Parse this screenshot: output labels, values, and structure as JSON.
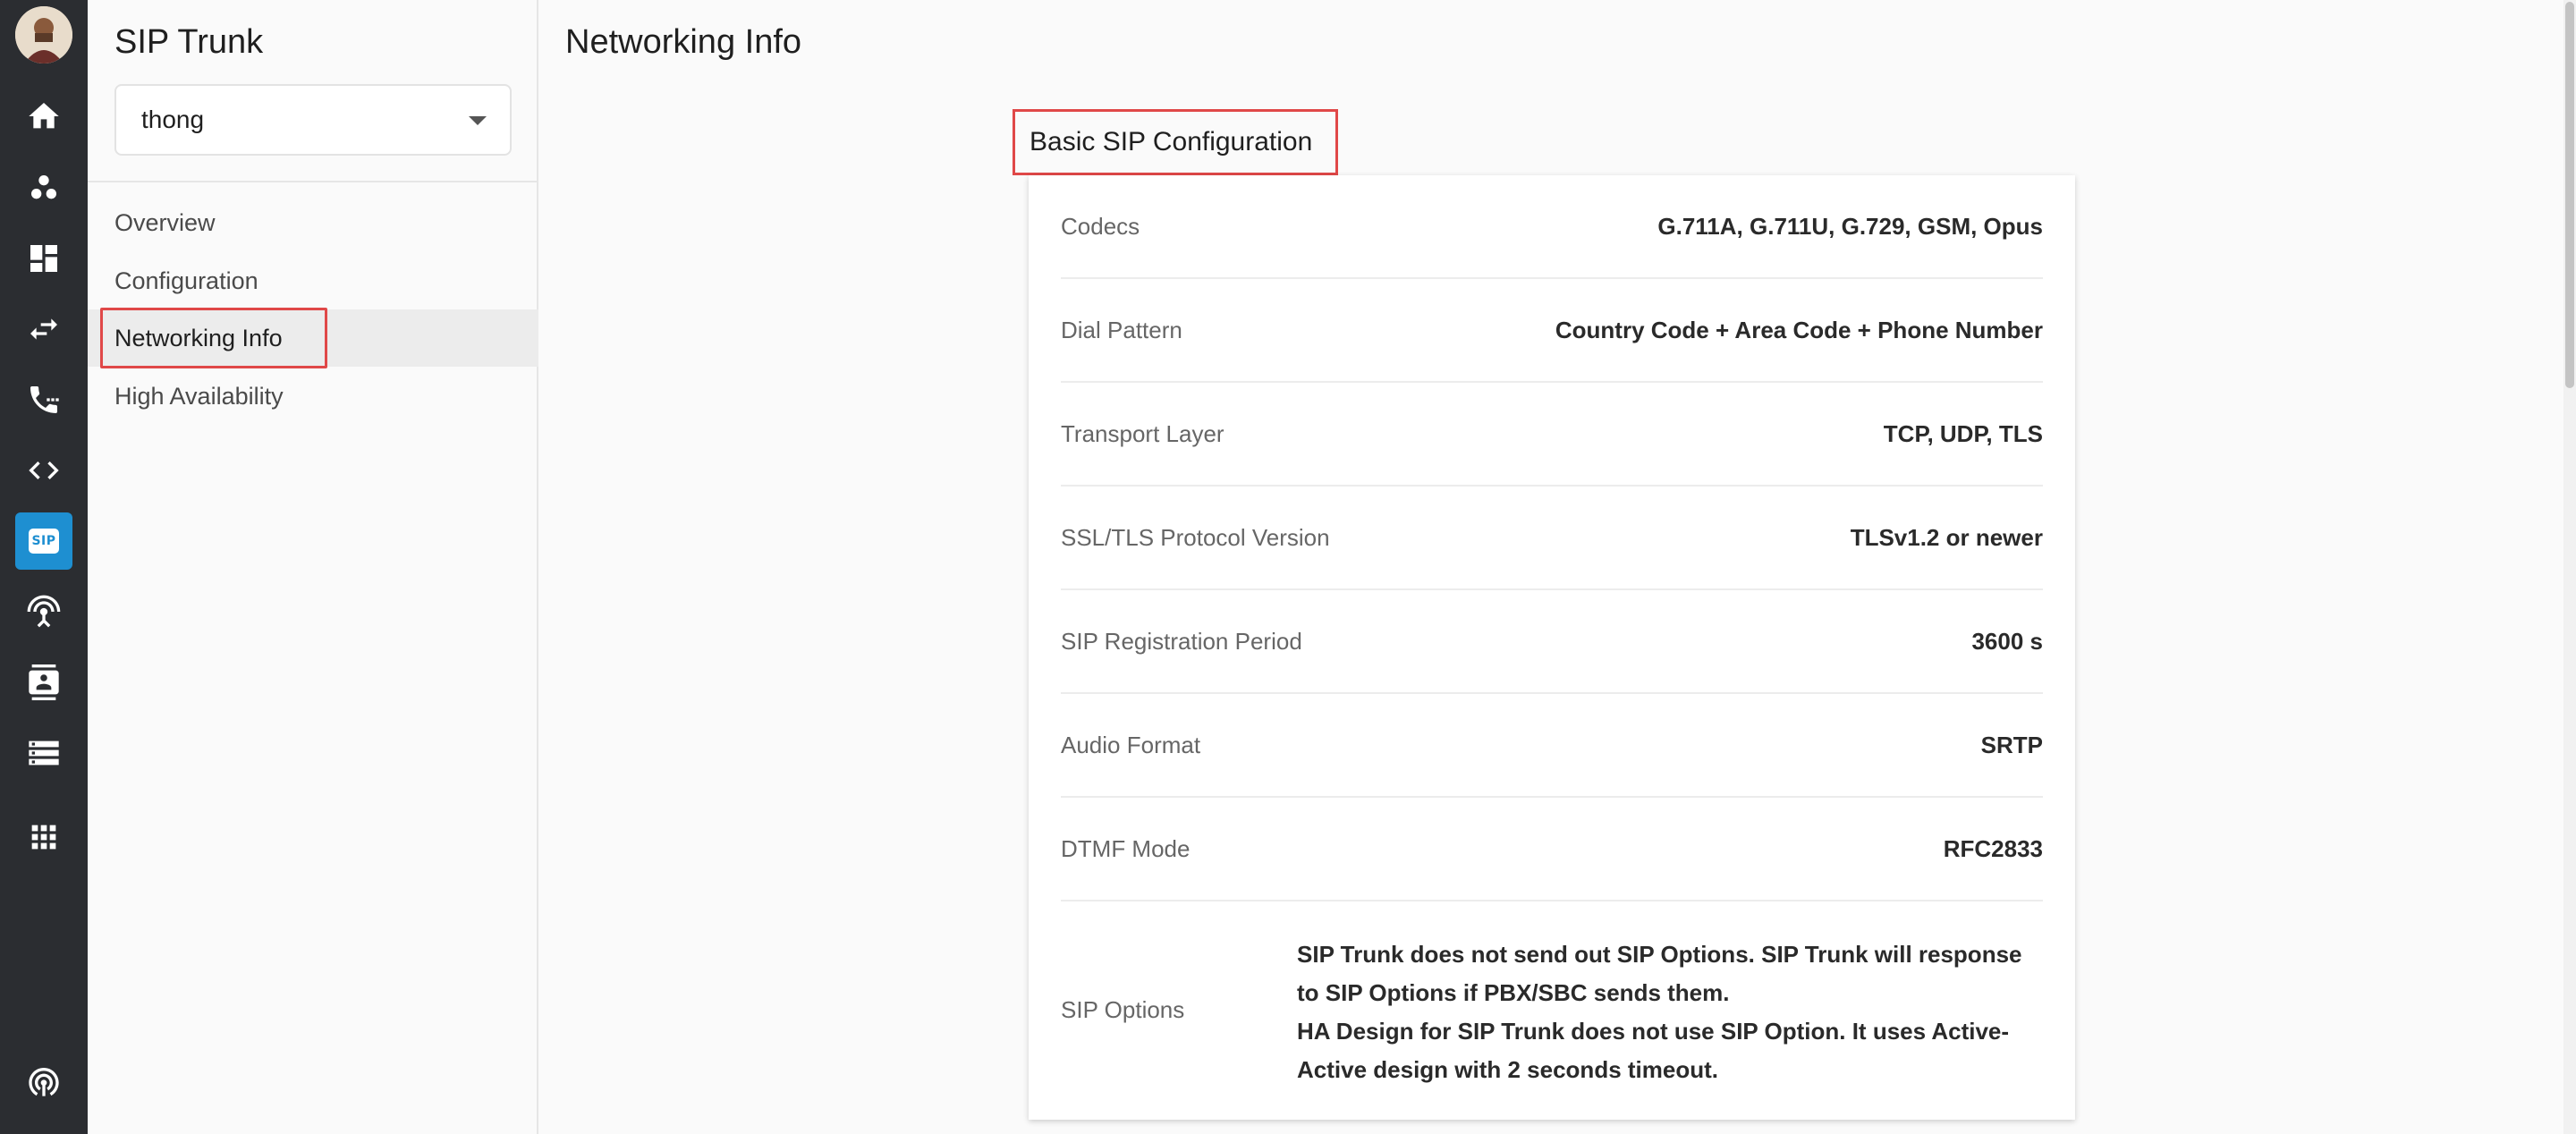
{
  "sidebar": {
    "title": "SIP Trunk",
    "select_value": "thong",
    "items": [
      {
        "label": "Overview"
      },
      {
        "label": "Configuration"
      },
      {
        "label": "Networking Info"
      },
      {
        "label": "High Availability"
      }
    ]
  },
  "rail": {
    "icons": [
      "home-icon",
      "users-icon",
      "dashboard-icon",
      "transfer-icon",
      "phone-icon",
      "code-icon",
      "sip-icon",
      "broadcast-icon",
      "contacts-icon",
      "storage-icon",
      "apps-icon",
      "signal-icon"
    ],
    "sip_label": "SIP",
    "active_color": "#1e8fd1"
  },
  "main": {
    "page_title": "Networking Info",
    "section_title": "Basic SIP Configuration",
    "rows": [
      {
        "label": "Codecs",
        "value": "G.711A, G.711U, G.729, GSM, Opus"
      },
      {
        "label": "Dial Pattern",
        "value": "Country Code + Area Code + Phone Number"
      },
      {
        "label": "Transport Layer",
        "value": "TCP, UDP, TLS"
      },
      {
        "label": "SSL/TLS Protocol Version",
        "value": "TLSv1.2 or newer"
      },
      {
        "label": "SIP Registration Period",
        "value": "3600 s"
      },
      {
        "label": "Audio Format",
        "value": "SRTP"
      },
      {
        "label": "DTMF Mode",
        "value": "RFC2833"
      },
      {
        "label": "SIP Options",
        "value_line1": "SIP Trunk does not send out SIP Options. SIP Trunk will response to SIP Options if PBX/SBC sends them.",
        "value_line2": "HA Design for SIP Trunk does not use SIP Option. It uses Active-Active design with 2 seconds timeout."
      }
    ]
  },
  "colors": {
    "highlight": "#e04848",
    "rail_bg": "#2b2d31"
  }
}
